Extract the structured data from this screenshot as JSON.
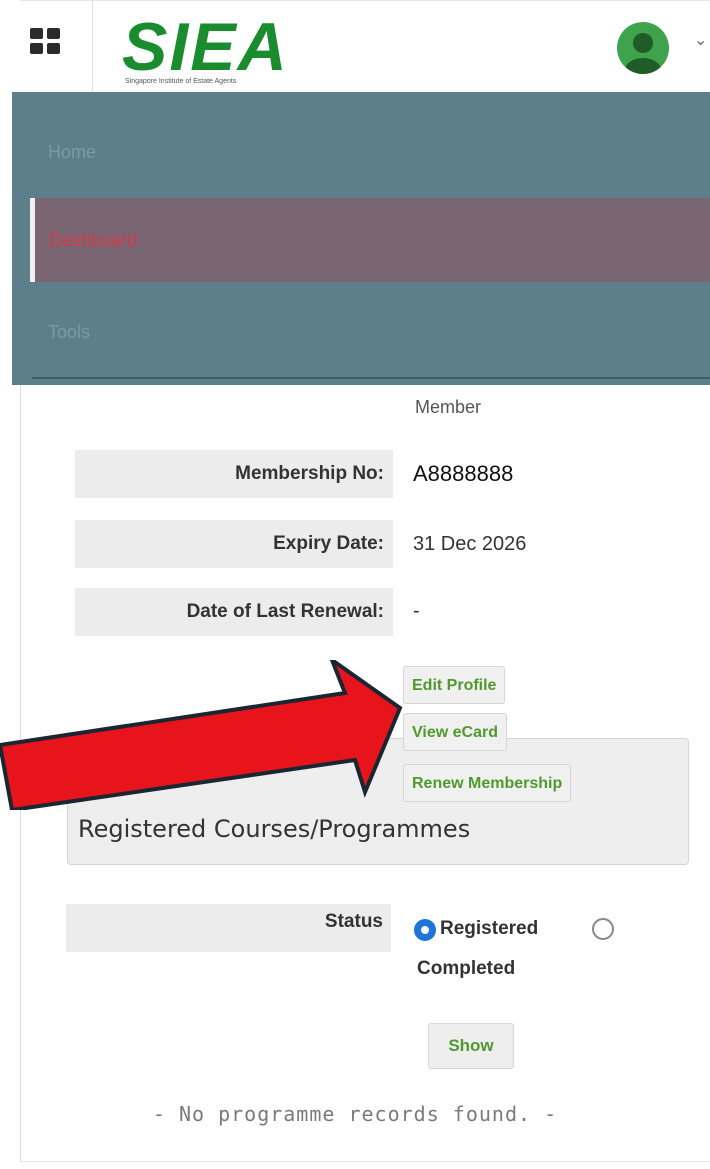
{
  "header": {
    "logo_text": "SIEA",
    "logo_tagline": "Singapore Institute of Estate Agents",
    "account_menu_icon": "chevron-down-icon"
  },
  "nav": {
    "items": [
      {
        "label": "Home"
      },
      {
        "label": "Dashboard",
        "active": true
      },
      {
        "label": "Tools"
      }
    ]
  },
  "profile": {
    "member_type": "Member",
    "rows": [
      {
        "label": "Membership No:",
        "value": "A8888888"
      },
      {
        "label": "Expiry Date:",
        "value": "31 Dec 2026"
      },
      {
        "label": "Date of Last Renewal:",
        "value": "-"
      }
    ]
  },
  "actions": {
    "edit_profile": "Edit Profile",
    "view_ecard": "View eCard",
    "renew_membership": "Renew Membership"
  },
  "courses": {
    "title": "Registered Courses/Programmes",
    "status_label": "Status",
    "status_options": [
      {
        "label": "Registered",
        "selected": true
      },
      {
        "label": "Completed",
        "selected": false
      }
    ],
    "show_button": "Show",
    "empty_message": "- No programme records found. -"
  },
  "colors": {
    "nav_bg": "#5d7f8c",
    "nav_active_bg": "#7a6672",
    "nav_active_text": "#d23a4a",
    "button_text": "#4f9a2e",
    "annotation_arrow": "#e8141c",
    "logo_green": "#1a8c2e"
  }
}
